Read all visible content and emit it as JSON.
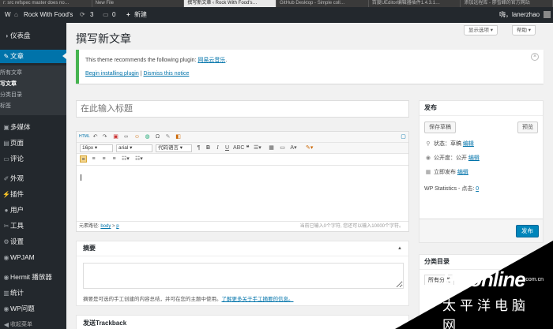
{
  "browser_tabs": [
    {
      "label": "r: src refspec master does no…",
      "active": false
    },
    {
      "label": "New File",
      "active": false
    },
    {
      "label": "撰写新文章 ‹ Rock With Food's…",
      "active": true
    },
    {
      "label": "GitHub Desktop - Simple coll…",
      "active": false
    },
    {
      "label": "百度UEditor编辑器插件1.4.3.1…",
      "active": false
    },
    {
      "label": "添加远程库 - 廖雪峰的官方网站",
      "active": false
    }
  ],
  "admin_bar": {
    "wp_logo": "W",
    "site_name": "Rock With Food's",
    "updates_count": "3",
    "comments_count": "0",
    "new_label": "新建",
    "greeting": "嗨，lanerzhao"
  },
  "sidebar": {
    "dashboard": "仪表盘",
    "posts": "文章",
    "submenu": [
      "所有文章",
      "写文章",
      "分类目录",
      "标签"
    ],
    "media": "多媒体",
    "pages": "页面",
    "comments": "评论",
    "appearance": "外观",
    "plugins": "插件",
    "users": "用户",
    "tools": "工具",
    "settings": "设置",
    "wpjam": "WPJAM",
    "hermit": "Hermit 播放器",
    "stats": "统计",
    "wpqa": "WP问题",
    "collapse": "收起菜单"
  },
  "screen_options": "显示选项 ▾",
  "help": "帮助 ▾",
  "page_title": "撰写新文章",
  "notice": {
    "message_prefix": "This theme recommends the following plugin: ",
    "plugin_name": "网易云音乐",
    "message_suffix": ".",
    "install_link": "Begin installing plugin",
    "separator": " | ",
    "dismiss_link": "Dismiss this notice"
  },
  "title_placeholder": "在此输入标题",
  "editor": {
    "font_size": "16px",
    "font_family": "arial",
    "code_language": "代码语言",
    "path_label": "元素路径: ",
    "path_body": "body",
    "path_sep": " > ",
    "path_p": "p",
    "char_count": "当前已输入0个字符, 您还可以输入10000个字符。"
  },
  "excerpt": {
    "title": "摘要",
    "help_prefix": "摘要是可选的手工创建的内容总结，并可在您的主题中使用。",
    "help_link": "了解更多关于手工摘要的信息。"
  },
  "trackback": {
    "title": "发送Trackback"
  },
  "publish": {
    "title": "发布",
    "save_draft": "保存草稿",
    "preview": "预览",
    "status_label": "状态：草稿",
    "status_edit": "编辑",
    "visibility_label": "公开度：公开",
    "visibility_edit": "编辑",
    "schedule_label": "立即发布",
    "schedule_edit": "编辑",
    "stats_label": "WP Statistics - 点击: ",
    "stats_value": "0",
    "publish_button": "发布"
  },
  "categories": {
    "title": "分类目录",
    "tab_all": "所有分类"
  },
  "watermark": {
    "brand": "PConline",
    "domain": ".com.cn",
    "cn_name": "太平洋电脑网"
  }
}
